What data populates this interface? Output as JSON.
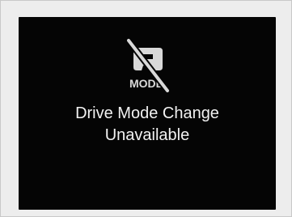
{
  "display": {
    "icon": {
      "name": "drive-mode-unavailable-icon",
      "label": "MODE",
      "slash": true
    },
    "message": {
      "line1": "Drive Mode Change",
      "line2": "Unavailable"
    },
    "colors": {
      "screen_background": "#050505",
      "text": "#f2f2f2",
      "icon": "#d9d9d9",
      "frame": "#ededed"
    }
  }
}
